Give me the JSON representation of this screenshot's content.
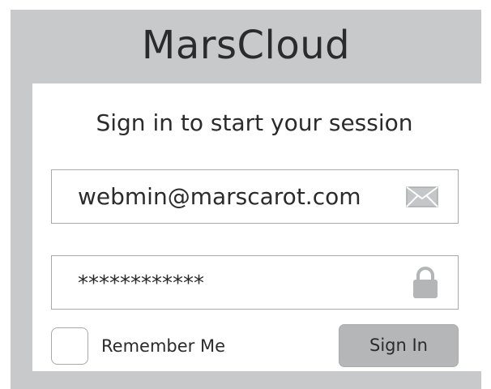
{
  "app": {
    "brand": "MarsCloud"
  },
  "login": {
    "subtitle": "Sign in to start your session",
    "email": {
      "value": "webmin@marscarot.com",
      "icon": "envelope-icon"
    },
    "password": {
      "value": "************",
      "icon": "lock-icon"
    },
    "remember_label": "Remember Me",
    "remember_checked": false,
    "signin_label": "Sign In"
  },
  "colors": {
    "frame_bg": "#c7c9ca",
    "card_bg": "#ffffff",
    "button_bg": "#b4b6b7",
    "text": "#2b2b2b",
    "icon": "#b3b5b6"
  }
}
